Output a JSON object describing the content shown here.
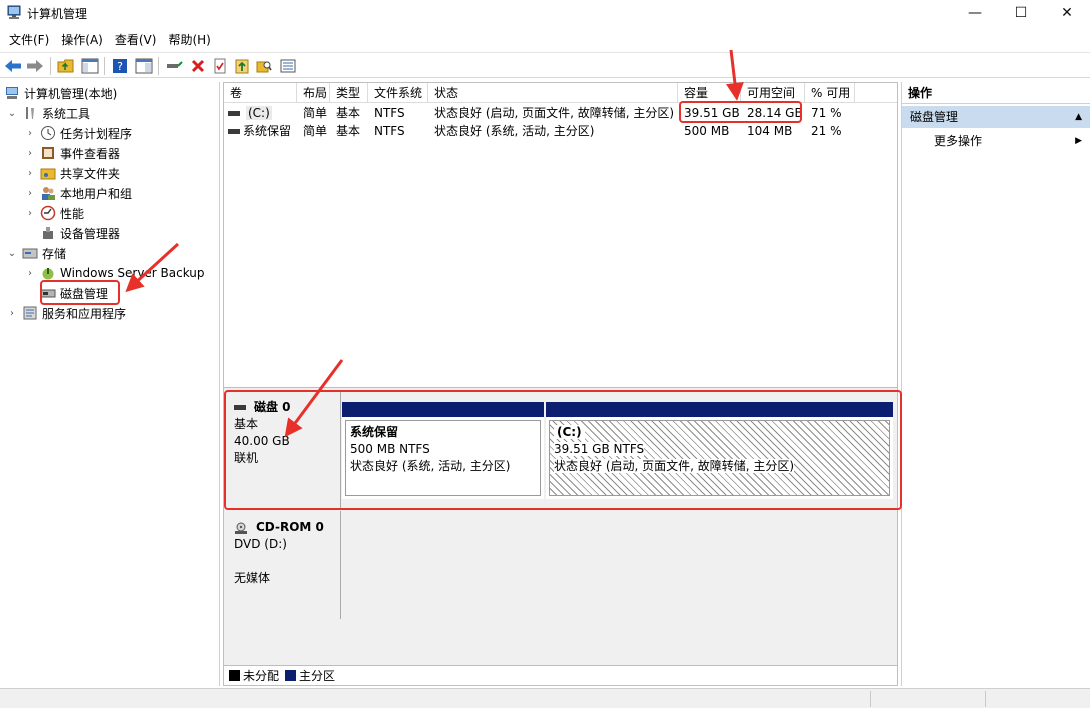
{
  "window": {
    "title": "计算机管理",
    "minimize": "—",
    "maximize": "☐",
    "close": "✕"
  },
  "menu": [
    "文件(F)",
    "操作(A)",
    "查看(V)",
    "帮助(H)"
  ],
  "tree": {
    "root": "计算机管理(本地)",
    "system_tools": "系统工具",
    "task_scheduler": "任务计划程序",
    "event_viewer": "事件查看器",
    "shared_folders": "共享文件夹",
    "local_users": "本地用户和组",
    "performance": "性能",
    "device_manager": "设备管理器",
    "storage": "存储",
    "windows_backup": "Windows Server Backup",
    "disk_management": "磁盘管理",
    "services_apps": "服务和应用程序"
  },
  "volume_list": {
    "columns": [
      "卷",
      "布局",
      "类型",
      "文件系统",
      "状态",
      "容量",
      "可用空间",
      "% 可用"
    ],
    "rows": [
      {
        "volume": "(C:)",
        "layout": "简单",
        "type": "基本",
        "fs": "NTFS",
        "status": "状态良好 (启动, 页面文件, 故障转储, 主分区)",
        "capacity": "39.51 GB",
        "free": "28.14 GB",
        "pct": "71 %"
      },
      {
        "volume": "系统保留",
        "layout": "简单",
        "type": "基本",
        "fs": "NTFS",
        "status": "状态良好 (系统, 活动, 主分区)",
        "capacity": "500 MB",
        "free": "104 MB",
        "pct": "21 %"
      }
    ]
  },
  "disks": [
    {
      "name": "磁盘 0",
      "type": "基本",
      "size": "40.00 GB",
      "state": "联机",
      "partitions": [
        {
          "name": "系统保留",
          "size_fs": "500 MB NTFS",
          "status": "状态良好 (系统, 活动, 主分区)"
        },
        {
          "name": "(C:)",
          "size_fs": "39.51 GB NTFS",
          "status": "状态良好 (启动, 页面文件, 故障转储, 主分区)"
        }
      ]
    },
    {
      "name": "CD-ROM 0",
      "type": "DVD (D:)",
      "state": "无媒体"
    }
  ],
  "legend": {
    "unallocated": "未分配",
    "primary": "主分区"
  },
  "actions": {
    "title": "操作",
    "section": "磁盘管理",
    "more": "更多操作"
  },
  "colors": {
    "primary_partition": "#0a1f6f",
    "annotation": "#e8302a",
    "action_section_bg": "#c9dcef"
  }
}
